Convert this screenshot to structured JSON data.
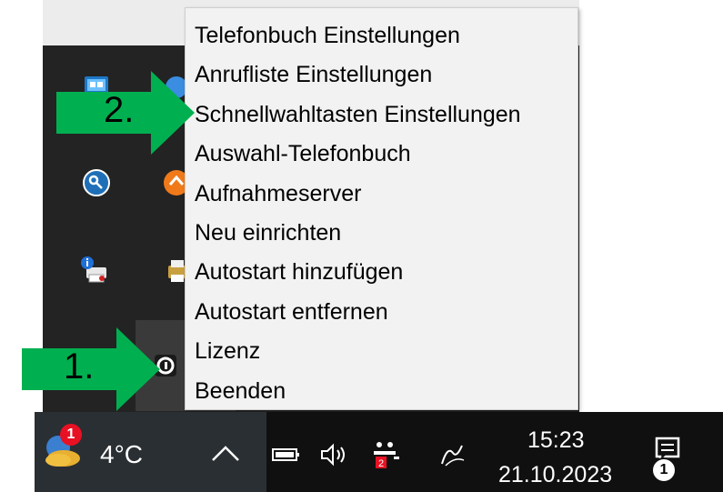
{
  "context_menu": {
    "items": [
      {
        "label": "Telefonbuch Einstellungen"
      },
      {
        "label": "Anrufliste Einstellungen"
      },
      {
        "label": "Schnellwahltasten Einstellungen"
      },
      {
        "label": "Auswahl-Telefonbuch"
      },
      {
        "label": "Aufnahmeserver"
      },
      {
        "label": "Neu einrichten"
      },
      {
        "label": "Autostart hinzufügen"
      },
      {
        "label": "Autostart entfernen"
      },
      {
        "label": "Lizenz"
      },
      {
        "label": "Beenden"
      }
    ]
  },
  "annotations": {
    "step1": "1.",
    "step2": "2."
  },
  "taskbar": {
    "weather": {
      "temperature": "4°C",
      "alert_count": "1"
    },
    "clock": {
      "time": "15:23",
      "date": "21.10.2023"
    },
    "notifications": {
      "count": "1"
    },
    "icons": [
      "weather-icon",
      "show-hidden-icons-chevron",
      "battery-icon",
      "volume-icon",
      "app-tray-icon",
      "pen-icon",
      "notification-center-icon"
    ]
  },
  "tray_overflow": {
    "icons": [
      "remote-desktop-icon",
      "key-icon",
      "printer-info-icon",
      "app-icon",
      "cloud-sync-icon",
      "printer-icon",
      "phone-app-icon"
    ]
  },
  "colors": {
    "annotation_arrow": "#00b050",
    "menu_background": "#f2f2f2",
    "taskbar": "#101010",
    "badge_red": "#e81123"
  }
}
